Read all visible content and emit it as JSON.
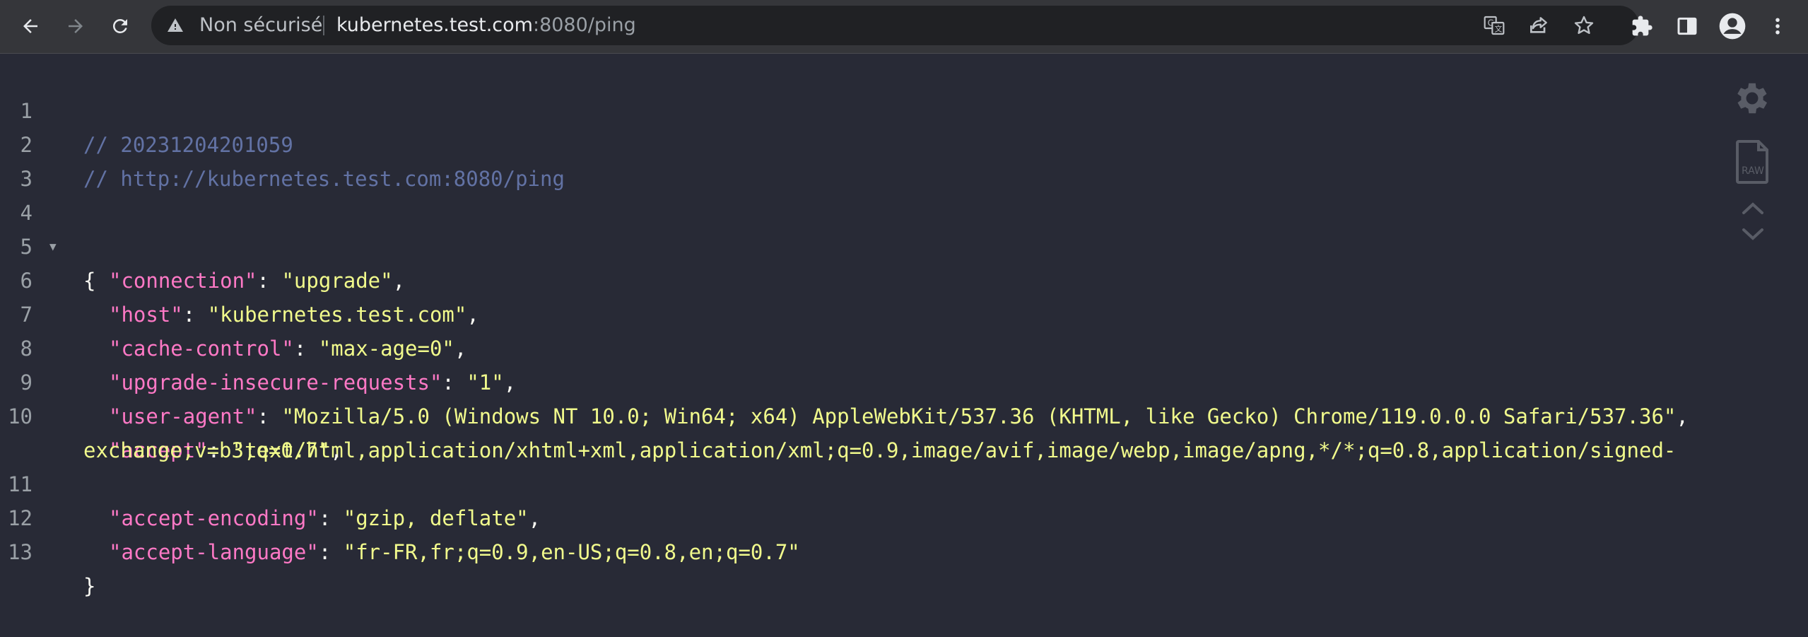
{
  "browser": {
    "security_label": "Non sécurisé",
    "url_host": "kubernetes.test.com",
    "url_rest": ":8080/ping"
  },
  "json_viewer": {
    "comment_timestamp": "// 20231204201059",
    "comment_url": "// http://kubernetes.test.com:8080/ping",
    "open_brace": "{",
    "close_brace": "}",
    "line_numbers": [
      "1",
      "2",
      "3",
      "4",
      "5",
      "6",
      "7",
      "8",
      "9",
      "10",
      "11",
      "12",
      "13"
    ],
    "entries": [
      {
        "key": "\"connection\"",
        "value": "\"upgrade\"",
        "trail": ","
      },
      {
        "key": "\"host\"",
        "value": "\"kubernetes.test.com\"",
        "trail": ","
      },
      {
        "key": "\"cache-control\"",
        "value": "\"max-age=0\"",
        "trail": ","
      },
      {
        "key": "\"upgrade-insecure-requests\"",
        "value": "\"1\"",
        "trail": ","
      },
      {
        "key": "\"user-agent\"",
        "value": "\"Mozilla/5.0 (Windows NT 10.0; Win64; x64) AppleWebKit/537.36 (KHTML, like Gecko) Chrome/119.0.0.0 Safari/537.36\"",
        "trail": ","
      },
      {
        "key": "\"accept\"",
        "value": "\"text/html,application/xhtml+xml,application/xml;q=0.9,image/avif,image/webp,image/apng,*/*;q=0.8,application/signed-",
        "trail": ""
      },
      {
        "key": "\"accept-encoding\"",
        "value": "\"gzip, deflate\"",
        "trail": ","
      },
      {
        "key": "\"accept-language\"",
        "value": "\"fr-FR,fr;q=0.9,en-US;q=0.8,en;q=0.7\"",
        "trail": ""
      }
    ],
    "accept_continuation": "exchange;v=b3;q=0.7\"",
    "accept_continuation_trail": ","
  },
  "colors": {
    "background": "#282a36",
    "comment": "#6272a4",
    "key": "#ff79c6",
    "string": "#f1fa8c",
    "punctuation": "#f8f8f2"
  },
  "icons": [
    "back-arrow-icon",
    "forward-arrow-icon",
    "reload-icon",
    "warning-icon",
    "translate-icon",
    "share-icon",
    "bookmark-star-icon",
    "extensions-icon",
    "side-panel-icon",
    "profile-icon",
    "menu-icon",
    "settings-gear-icon",
    "raw-file-icon",
    "collapse-chevron-icon",
    "expand-chevron-icon",
    "fold-toggle-icon"
  ]
}
